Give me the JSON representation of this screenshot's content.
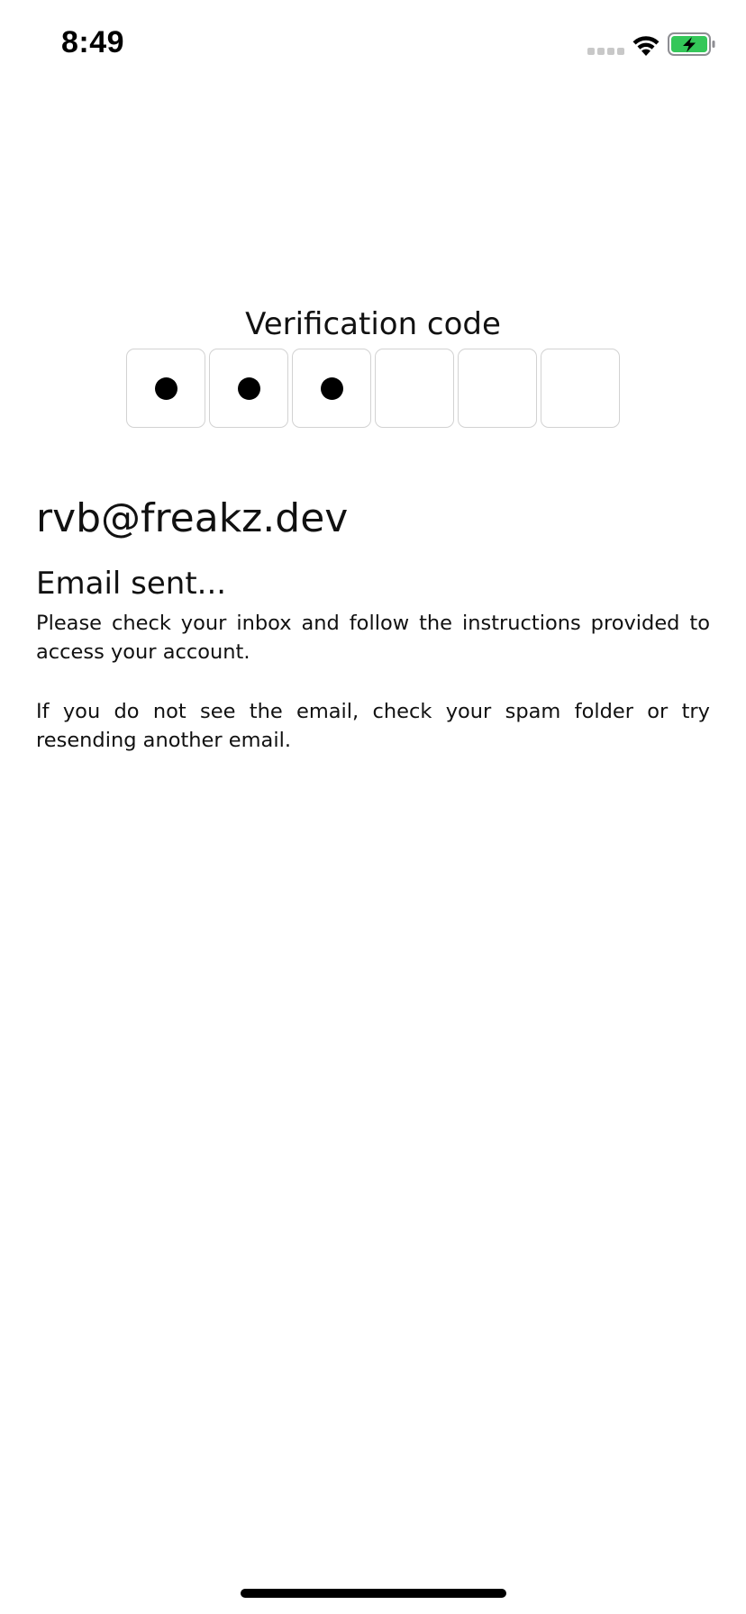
{
  "status_bar": {
    "time": "8:49",
    "signal_icon": "signal-dots-icon",
    "wifi_icon": "wifi-icon",
    "battery_icon": "battery-charging-icon",
    "battery_color": "#34c759"
  },
  "verification": {
    "title": "Verification code",
    "digits_total": 6,
    "digits_entered": 3,
    "mask_char": "●"
  },
  "account": {
    "email": "rvb@freakz.dev"
  },
  "message": {
    "title": "Email sent...",
    "body": "Please check your inbox and follow the instructions provided to access your account.",
    "hint": "If you do not see the email, check your spam folder or try resending another email."
  }
}
